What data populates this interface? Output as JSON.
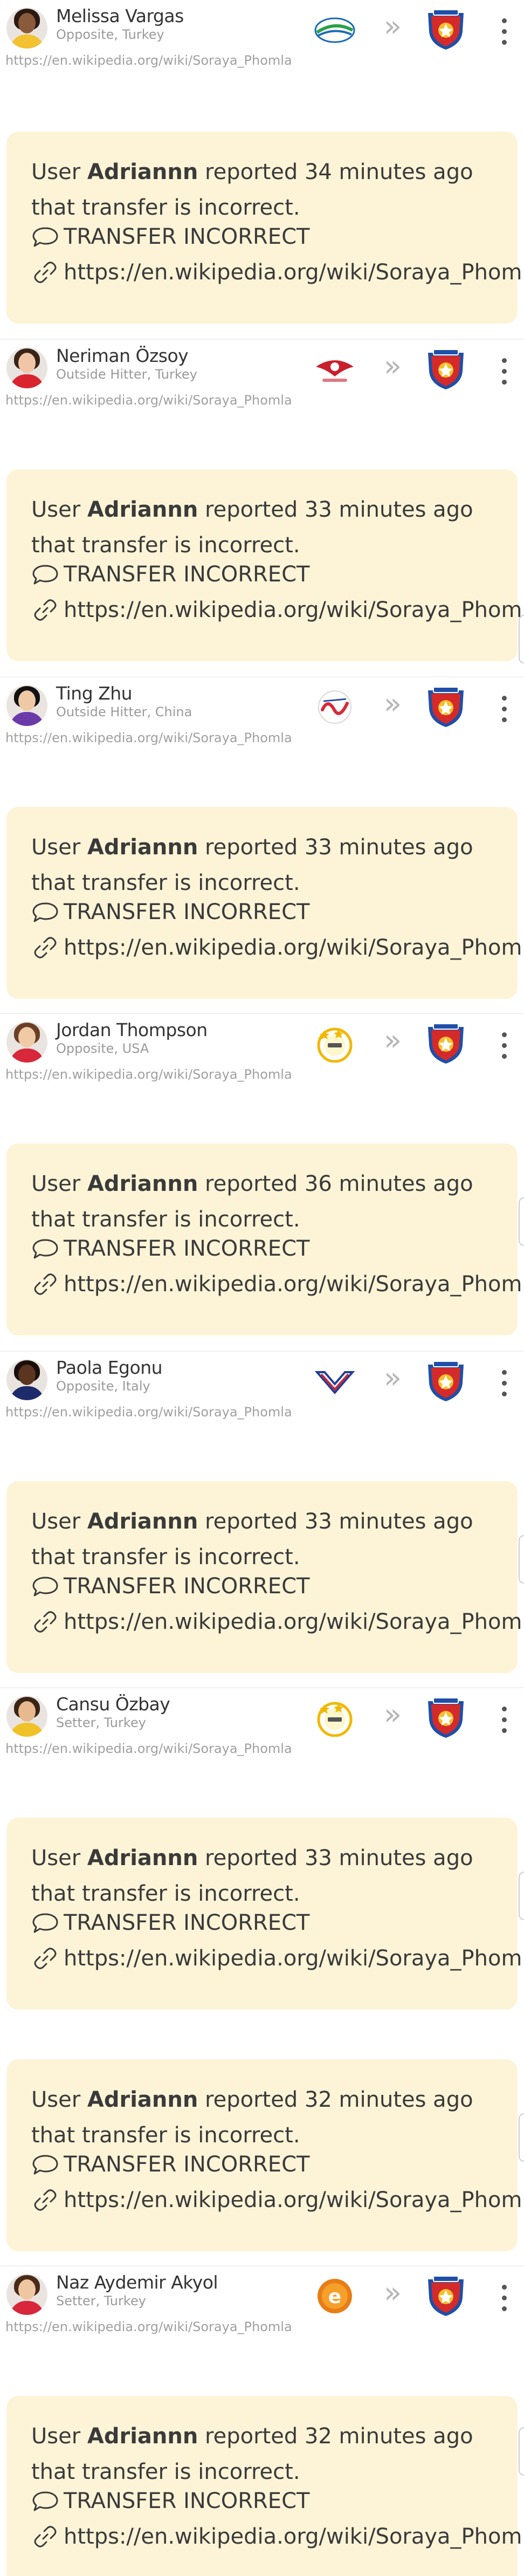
{
  "source_url": "https://en.wikipedia.org/wiki/Soraya_Phomla",
  "transfers": [
    {
      "name": "Melissa Vargas",
      "meta": "Opposite, Turkey",
      "skin": "#8a5a3c",
      "hair": "#2a1a12",
      "shirt": "#f2c230",
      "club_from_icon": "ball-club-logo",
      "accent": "#1a6bb8"
    },
    {
      "name": "Neriman Özsoy",
      "meta": "Outside Hitter, Turkey",
      "skin": "#f1c6a8",
      "hair": "#3a2418",
      "shirt": "#d9232f",
      "club_from_icon": "wing-club-logo",
      "accent": "#c9202c"
    },
    {
      "name": "Ting Zhu",
      "meta": "Outside Hitter, China",
      "skin": "#efc8a4",
      "hair": "#111111",
      "shirt": "#6a3aa8",
      "club_from_icon": "script-club-logo",
      "accent": "#d42b38"
    },
    {
      "name": "Jordan Thompson",
      "meta": "Opposite, USA",
      "skin": "#f0c9a6",
      "hair": "#6b3f25",
      "shirt": "#d8263a",
      "club_from_icon": "stars-club-logo",
      "accent": "#f2b800"
    },
    {
      "name": "Paola Egonu",
      "meta": "Opposite, Italy",
      "skin": "#5b3520",
      "hair": "#1a0f0a",
      "shirt": "#1d2b6b",
      "club_from_icon": "v-club-logo",
      "accent": "#c8283a"
    },
    {
      "name": "Cansu Özbay",
      "meta": "Setter, Turkey",
      "skin": "#e8b98f",
      "hair": "#3b2415",
      "shirt": "#f0c228",
      "club_from_icon": "stars-club-logo",
      "accent": "#f2b800"
    },
    {
      "name": "Naz Aydemir Akyol",
      "meta": "Setter, Turkey",
      "skin": "#efc6a2",
      "hair": "#4a2a18",
      "shirt": "#d8263a",
      "club_from_icon": "e-club-logo",
      "accent": "#e87d16"
    }
  ],
  "reports": [
    {
      "prefix": "User ",
      "user": "Adriannn",
      "suffix": " reported 34 minutes ago that transfer is incorrect.",
      "type": "TRANSFER INCORRECT",
      "link": "https://en.wikipedia.org/wiki/Soraya_Phomla"
    },
    {
      "prefix": "User ",
      "user": "Adriannn",
      "suffix": " reported 33 minutes ago that transfer is incorrect.",
      "type": "TRANSFER INCORRECT",
      "link": "https://en.wikipedia.org/wiki/Soraya_Phomla"
    },
    {
      "prefix": "User ",
      "user": "Adriannn",
      "suffix": " reported 33 minutes ago that transfer is incorrect.",
      "type": "TRANSFER INCORRECT",
      "link": "https://en.wikipedia.org/wiki/Soraya_Phomla"
    },
    {
      "prefix": "User ",
      "user": "Adriannn",
      "suffix": " reported 36 minutes ago that transfer is incorrect.",
      "type": "TRANSFER INCORRECT",
      "link": "https://en.wikipedia.org/wiki/Soraya_Phomla"
    },
    {
      "prefix": "User ",
      "user": "Adriannn",
      "suffix": " reported 33 minutes ago that transfer is incorrect.",
      "type": "TRANSFER INCORRECT",
      "link": "https://en.wikipedia.org/wiki/Soraya_Phomla"
    },
    {
      "prefix": "User ",
      "user": "Adriannn",
      "suffix": " reported 33 minutes ago that transfer is incorrect.",
      "type": "TRANSFER INCORRECT",
      "link": "https://en.wikipedia.org/wiki/Soraya_Phomla"
    },
    {
      "prefix": "User ",
      "user": "Adriannn",
      "suffix": " reported 32 minutes ago that transfer is incorrect.",
      "type": "TRANSFER INCORRECT",
      "link": "https://en.wikipedia.org/wiki/Soraya_Phomla"
    },
    {
      "prefix": "User ",
      "user": "Adriannn",
      "suffix": " reported 32 minutes ago that transfer is incorrect.",
      "type": "TRANSFER INCORRECT",
      "link": "https://en.wikipedia.org/wiki/Soraya_Phomla"
    }
  ],
  "icons": {
    "arrows": "»",
    "comment": "comment-icon",
    "link": "link-icon",
    "menu": "more-vertical-icon",
    "club_to": "club-crest-icon"
  }
}
